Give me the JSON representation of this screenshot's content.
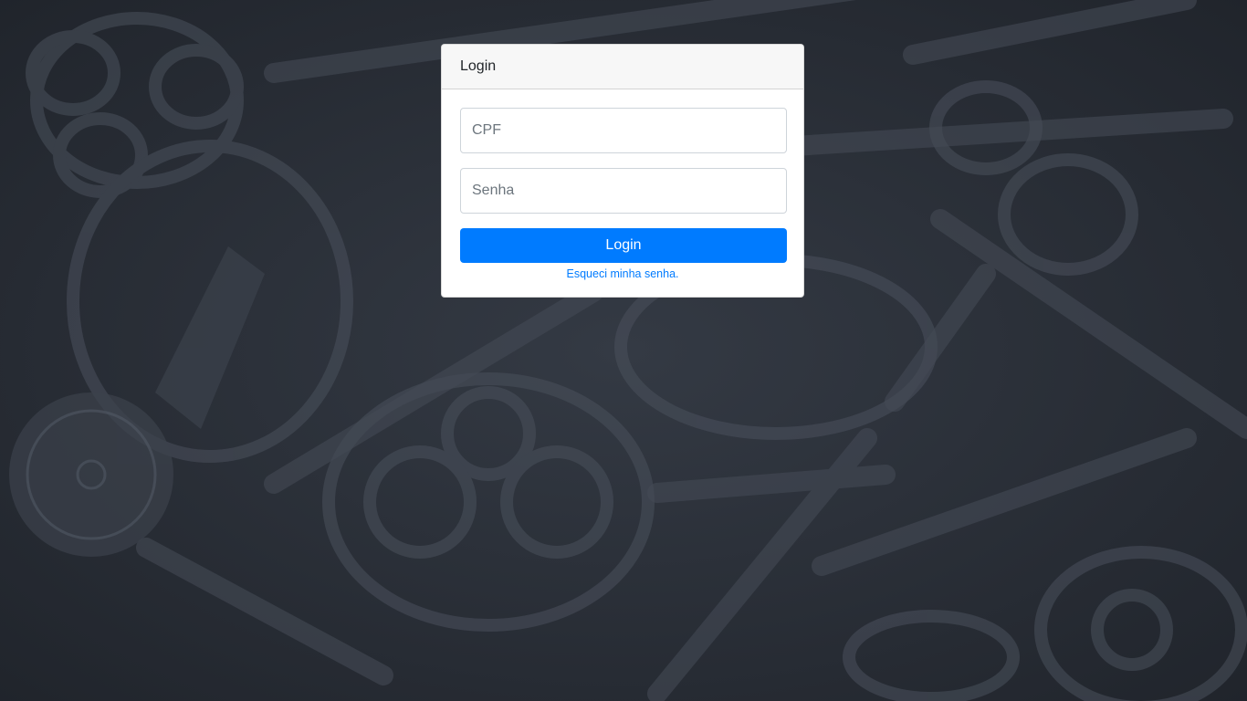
{
  "login_card": {
    "title": "Login",
    "cpf_placeholder": "CPF",
    "password_placeholder": "Senha",
    "submit_label": "Login",
    "forgot_password_link": "Esqueci minha senha."
  },
  "colors": {
    "background": "#2a2f37",
    "primary": "#007bff",
    "card_header": "#f7f7f7"
  },
  "background_image": "dark-vintage-keys-photo"
}
